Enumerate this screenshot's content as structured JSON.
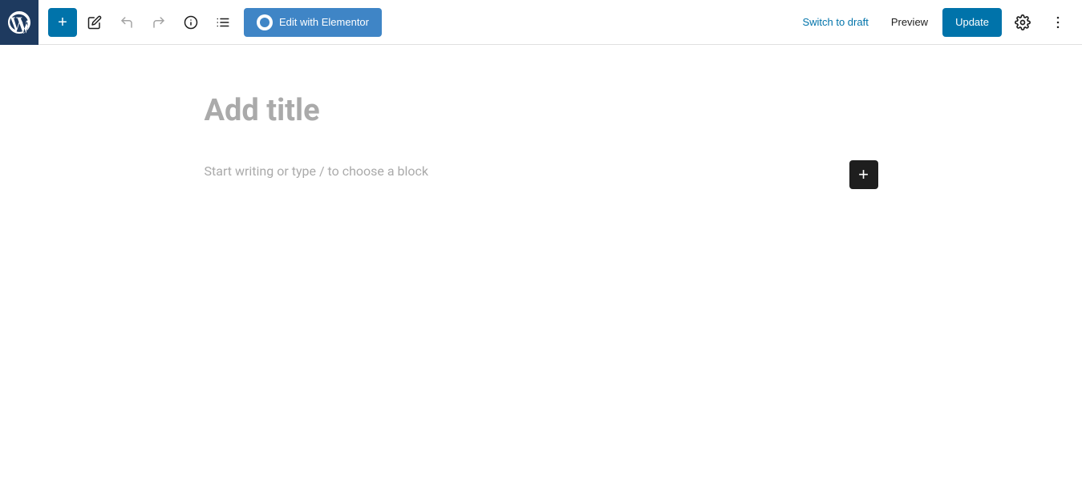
{
  "toolbar": {
    "add_label": "+",
    "elementor_button_label": "Edit with Elementor",
    "switch_draft_label": "Switch to draft",
    "preview_label": "Preview",
    "update_label": "Update"
  },
  "editor": {
    "title_placeholder": "Add title",
    "content_placeholder": "Start writing or type / to choose a block"
  },
  "icons": {
    "add": "+",
    "pencil": "✏",
    "undo": "↩",
    "redo": "↪",
    "info": "ℹ",
    "list": "≡",
    "settings": "⚙",
    "more": "⋮",
    "add_block": "+"
  }
}
